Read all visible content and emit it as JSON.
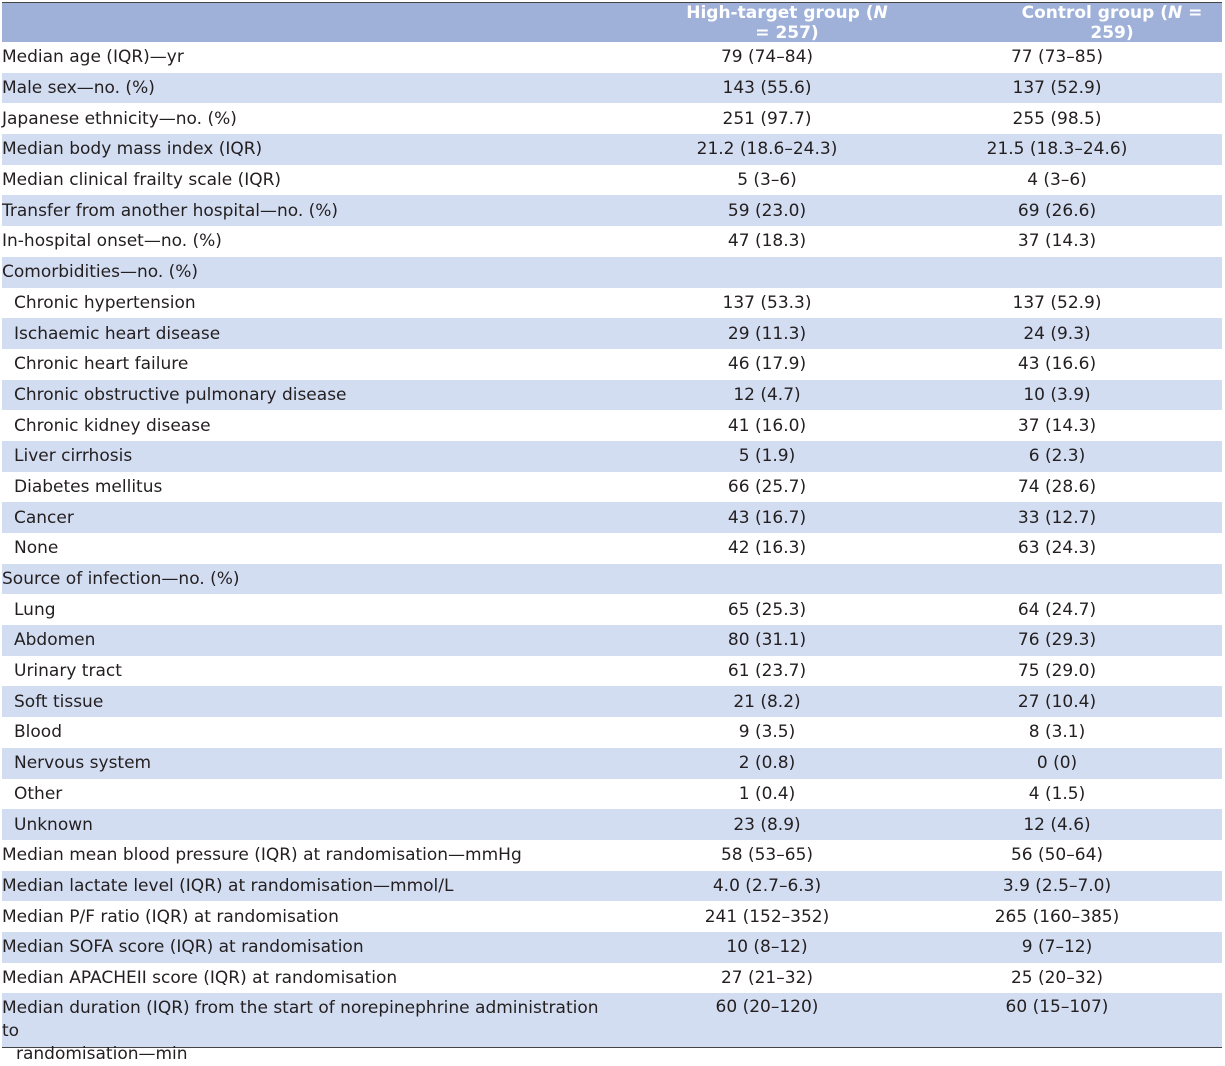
{
  "header": {
    "group_a_prefix": "High-target group (",
    "group_a_n_label": "N",
    "group_a_n_value": " = 257)",
    "group_b_prefix": "Control group (",
    "group_b_n_label": "N",
    "group_b_n_value": " = 259)"
  },
  "rows": [
    {
      "label": "Median age (IQR)—yr",
      "a": "79 (74–84)",
      "b": "77 (73–85)"
    },
    {
      "label": "Male sex—no. (%)",
      "a": "143 (55.6)",
      "b": "137 (52.9)"
    },
    {
      "label": "Japanese ethnicity—no. (%)",
      "a": "251 (97.7)",
      "b": "255 (98.5)"
    },
    {
      "label": "Median body mass index (IQR)",
      "a": "21.2 (18.6–24.3)",
      "b": "21.5 (18.3–24.6)"
    },
    {
      "label": "Median clinical frailty scale (IQR)",
      "a": "5 (3–6)",
      "b": "4 (3–6)"
    },
    {
      "label": "Transfer from another hospital—no. (%)",
      "a": "59 (23.0)",
      "b": "69 (26.6)"
    },
    {
      "label": "In-hospital onset—no. (%)",
      "a": "47 (18.3)",
      "b": "37 (14.3)"
    },
    {
      "label": "Comorbidities—no. (%)",
      "a": "",
      "b": ""
    },
    {
      "label": "Chronic hypertension",
      "a": "137 (53.3)",
      "b": "137 (52.9)"
    },
    {
      "label": "Ischaemic heart disease",
      "a": "29 (11.3)",
      "b": "24 (9.3)"
    },
    {
      "label": "Chronic heart failure",
      "a": "46 (17.9)",
      "b": "43 (16.6)"
    },
    {
      "label": "Chronic obstructive pulmonary disease",
      "a": "12 (4.7)",
      "b": "10 (3.9)"
    },
    {
      "label": "Chronic kidney disease",
      "a": "41 (16.0)",
      "b": "37 (14.3)"
    },
    {
      "label": "Liver cirrhosis",
      "a": "5 (1.9)",
      "b": "6 (2.3)"
    },
    {
      "label": "Diabetes mellitus",
      "a": "66 (25.7)",
      "b": "74 (28.6)"
    },
    {
      "label": "Cancer",
      "a": "43 (16.7)",
      "b": "33 (12.7)"
    },
    {
      "label": "None",
      "a": "42 (16.3)",
      "b": "63 (24.3)"
    },
    {
      "label": "Source of infection—no. (%)",
      "a": "",
      "b": ""
    },
    {
      "label": "Lung",
      "a": "65 (25.3)",
      "b": "64 (24.7)"
    },
    {
      "label": "Abdomen",
      "a": "80 (31.1)",
      "b": "76 (29.3)"
    },
    {
      "label": "Urinary tract",
      "a": "61 (23.7)",
      "b": "75 (29.0)"
    },
    {
      "label": "Soft tissue",
      "a": "21 (8.2)",
      "b": "27 (10.4)"
    },
    {
      "label": "Blood",
      "a": "9 (3.5)",
      "b": "8 (3.1)"
    },
    {
      "label": "Nervous system",
      "a": "2 (0.8)",
      "b": "0 (0)"
    },
    {
      "label": "Other",
      "a": "1 (0.4)",
      "b": "4 (1.5)"
    },
    {
      "label": "Unknown",
      "a": "23 (8.9)",
      "b": "12 (4.6)"
    },
    {
      "label": "Median mean blood pressure (IQR) at randomisation—mmHg",
      "a": "58 (53–65)",
      "b": "56 (50–64)"
    },
    {
      "label": "Median lactate level (IQR) at randomisation—mmol/L",
      "a": "4.0 (2.7–6.3)",
      "b": "3.9 (2.5–7.0)"
    },
    {
      "label": "Median P/F ratio (IQR) at randomisation",
      "a": "241 (152–352)",
      "b": "265 (160–385)"
    },
    {
      "label": "Median SOFA score (IQR) at randomisation",
      "a": "10 (8–12)",
      "b": "9 (7–12)"
    },
    {
      "label": "Median APACHEII score (IQR) at randomisation",
      "a": "27 (21–32)",
      "b": "25 (20–32)"
    },
    {
      "label_line1": "Median duration (IQR) from the start of norepinephrine administration to",
      "label_line2": "randomisation—min",
      "a": "60 (20–120)",
      "b": "60 (15–107)"
    }
  ]
}
